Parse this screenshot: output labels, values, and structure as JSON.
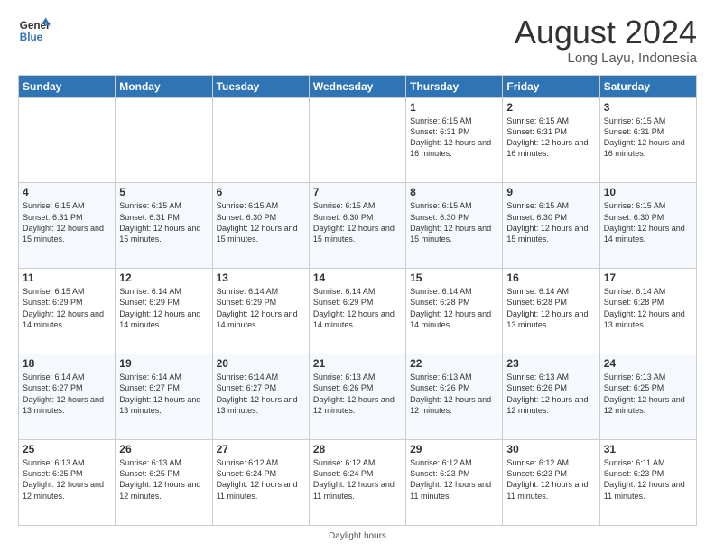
{
  "header": {
    "logo_line1": "General",
    "logo_line2": "Blue",
    "main_title": "August 2024",
    "subtitle": "Long Layu, Indonesia"
  },
  "days_of_week": [
    "Sunday",
    "Monday",
    "Tuesday",
    "Wednesday",
    "Thursday",
    "Friday",
    "Saturday"
  ],
  "weeks": [
    [
      {
        "day": "",
        "detail": ""
      },
      {
        "day": "",
        "detail": ""
      },
      {
        "day": "",
        "detail": ""
      },
      {
        "day": "",
        "detail": ""
      },
      {
        "day": "1",
        "detail": "Sunrise: 6:15 AM\nSunset: 6:31 PM\nDaylight: 12 hours and 16 minutes."
      },
      {
        "day": "2",
        "detail": "Sunrise: 6:15 AM\nSunset: 6:31 PM\nDaylight: 12 hours and 16 minutes."
      },
      {
        "day": "3",
        "detail": "Sunrise: 6:15 AM\nSunset: 6:31 PM\nDaylight: 12 hours and 16 minutes."
      }
    ],
    [
      {
        "day": "4",
        "detail": "Sunrise: 6:15 AM\nSunset: 6:31 PM\nDaylight: 12 hours and 15 minutes."
      },
      {
        "day": "5",
        "detail": "Sunrise: 6:15 AM\nSunset: 6:31 PM\nDaylight: 12 hours and 15 minutes."
      },
      {
        "day": "6",
        "detail": "Sunrise: 6:15 AM\nSunset: 6:30 PM\nDaylight: 12 hours and 15 minutes."
      },
      {
        "day": "7",
        "detail": "Sunrise: 6:15 AM\nSunset: 6:30 PM\nDaylight: 12 hours and 15 minutes."
      },
      {
        "day": "8",
        "detail": "Sunrise: 6:15 AM\nSunset: 6:30 PM\nDaylight: 12 hours and 15 minutes."
      },
      {
        "day": "9",
        "detail": "Sunrise: 6:15 AM\nSunset: 6:30 PM\nDaylight: 12 hours and 15 minutes."
      },
      {
        "day": "10",
        "detail": "Sunrise: 6:15 AM\nSunset: 6:30 PM\nDaylight: 12 hours and 14 minutes."
      }
    ],
    [
      {
        "day": "11",
        "detail": "Sunrise: 6:15 AM\nSunset: 6:29 PM\nDaylight: 12 hours and 14 minutes."
      },
      {
        "day": "12",
        "detail": "Sunrise: 6:14 AM\nSunset: 6:29 PM\nDaylight: 12 hours and 14 minutes."
      },
      {
        "day": "13",
        "detail": "Sunrise: 6:14 AM\nSunset: 6:29 PM\nDaylight: 12 hours and 14 minutes."
      },
      {
        "day": "14",
        "detail": "Sunrise: 6:14 AM\nSunset: 6:29 PM\nDaylight: 12 hours and 14 minutes."
      },
      {
        "day": "15",
        "detail": "Sunrise: 6:14 AM\nSunset: 6:28 PM\nDaylight: 12 hours and 14 minutes."
      },
      {
        "day": "16",
        "detail": "Sunrise: 6:14 AM\nSunset: 6:28 PM\nDaylight: 12 hours and 13 minutes."
      },
      {
        "day": "17",
        "detail": "Sunrise: 6:14 AM\nSunset: 6:28 PM\nDaylight: 12 hours and 13 minutes."
      }
    ],
    [
      {
        "day": "18",
        "detail": "Sunrise: 6:14 AM\nSunset: 6:27 PM\nDaylight: 12 hours and 13 minutes."
      },
      {
        "day": "19",
        "detail": "Sunrise: 6:14 AM\nSunset: 6:27 PM\nDaylight: 12 hours and 13 minutes."
      },
      {
        "day": "20",
        "detail": "Sunrise: 6:14 AM\nSunset: 6:27 PM\nDaylight: 12 hours and 13 minutes."
      },
      {
        "day": "21",
        "detail": "Sunrise: 6:13 AM\nSunset: 6:26 PM\nDaylight: 12 hours and 12 minutes."
      },
      {
        "day": "22",
        "detail": "Sunrise: 6:13 AM\nSunset: 6:26 PM\nDaylight: 12 hours and 12 minutes."
      },
      {
        "day": "23",
        "detail": "Sunrise: 6:13 AM\nSunset: 6:26 PM\nDaylight: 12 hours and 12 minutes."
      },
      {
        "day": "24",
        "detail": "Sunrise: 6:13 AM\nSunset: 6:25 PM\nDaylight: 12 hours and 12 minutes."
      }
    ],
    [
      {
        "day": "25",
        "detail": "Sunrise: 6:13 AM\nSunset: 6:25 PM\nDaylight: 12 hours and 12 minutes."
      },
      {
        "day": "26",
        "detail": "Sunrise: 6:13 AM\nSunset: 6:25 PM\nDaylight: 12 hours and 12 minutes."
      },
      {
        "day": "27",
        "detail": "Sunrise: 6:12 AM\nSunset: 6:24 PM\nDaylight: 12 hours and 11 minutes."
      },
      {
        "day": "28",
        "detail": "Sunrise: 6:12 AM\nSunset: 6:24 PM\nDaylight: 12 hours and 11 minutes."
      },
      {
        "day": "29",
        "detail": "Sunrise: 6:12 AM\nSunset: 6:23 PM\nDaylight: 12 hours and 11 minutes."
      },
      {
        "day": "30",
        "detail": "Sunrise: 6:12 AM\nSunset: 6:23 PM\nDaylight: 12 hours and 11 minutes."
      },
      {
        "day": "31",
        "detail": "Sunrise: 6:11 AM\nSunset: 6:23 PM\nDaylight: 12 hours and 11 minutes."
      }
    ]
  ],
  "footer_text": "Daylight hours"
}
